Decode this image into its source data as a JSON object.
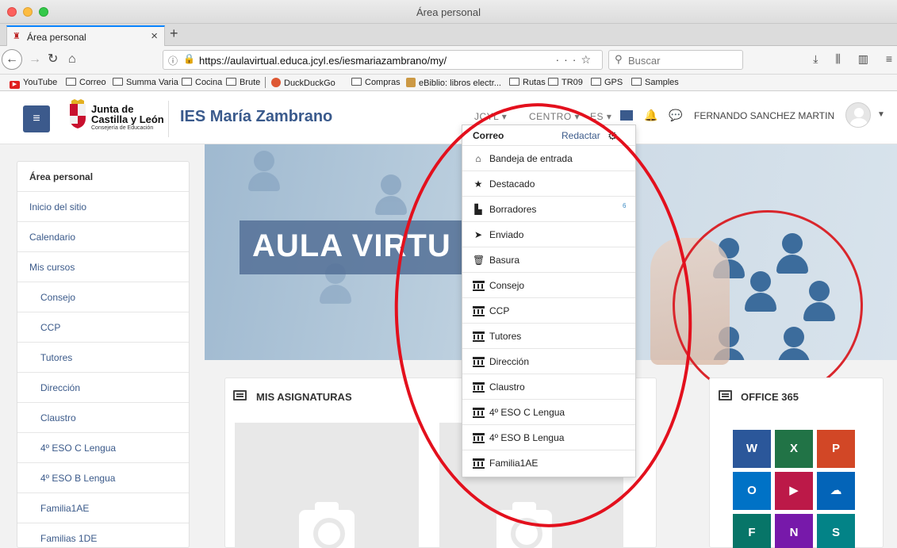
{
  "window": {
    "title": "Área personal"
  },
  "browser": {
    "tab": {
      "label": "Área personal"
    },
    "url": "https://aulavirtual.educa.jcyl.es/iesmariazambrano/my/",
    "search_placeholder": "Buscar",
    "bookmarks": [
      "YouTube",
      "Correo",
      "Summa Varia",
      "Cocina",
      "Brute",
      "DuckDuckGo",
      "Compras",
      "eBiblio: libros electr...",
      "Rutas",
      "TR09",
      "GPS",
      "Samples"
    ]
  },
  "header": {
    "logo_line1": "Junta de",
    "logo_line2": "Castilla y León",
    "logo_line3": "Consejería de Educación",
    "site_name": "IES María Zambrano",
    "menu": [
      {
        "label": "JCYL"
      },
      {
        "label": "CENTRO"
      },
      {
        "label": "ES"
      }
    ],
    "user_name": "FERNANDO SANCHEZ MARTIN"
  },
  "sidebar": {
    "items": [
      {
        "label": "Área personal"
      },
      {
        "label": "Inicio del sitio"
      },
      {
        "label": "Calendario"
      },
      {
        "label": "Mis cursos"
      },
      {
        "label": "Consejo"
      },
      {
        "label": "CCP"
      },
      {
        "label": "Tutores"
      },
      {
        "label": "Dirección"
      },
      {
        "label": "Claustro"
      },
      {
        "label": "4º ESO C Lengua"
      },
      {
        "label": "4º ESO B Lengua"
      },
      {
        "label": "Familia1AE"
      },
      {
        "label": "Familias 1DE"
      }
    ]
  },
  "hero": {
    "text": "AULA VIRTU"
  },
  "cards": {
    "courses_title": "MIS ASIGNATURAS",
    "office_title": "OFFICE 365"
  },
  "mail_dropdown": {
    "title": "Correo",
    "compose": "Redactar",
    "items": [
      {
        "label": "Bandeja de entrada",
        "icon": "inbox-icon"
      },
      {
        "label": "Destacado",
        "icon": "star-icon"
      },
      {
        "label": "Borradores",
        "icon": "file-icon",
        "badge": "6"
      },
      {
        "label": "Enviado",
        "icon": "paper-plane-icon"
      },
      {
        "label": "Basura",
        "icon": "trash-icon"
      },
      {
        "label": "Consejo",
        "icon": "institution-icon"
      },
      {
        "label": "CCP",
        "icon": "institution-icon"
      },
      {
        "label": "Tutores",
        "icon": "institution-icon"
      },
      {
        "label": "Dirección",
        "icon": "institution-icon"
      },
      {
        "label": "Claustro",
        "icon": "institution-icon"
      },
      {
        "label": "4º ESO C Lengua",
        "icon": "institution-icon"
      },
      {
        "label": "4º ESO B Lengua",
        "icon": "institution-icon"
      },
      {
        "label": "Familia1AE",
        "icon": "institution-icon"
      }
    ]
  },
  "colors": {
    "brand": "#3a5a8c",
    "annotation": "#e3101d"
  }
}
